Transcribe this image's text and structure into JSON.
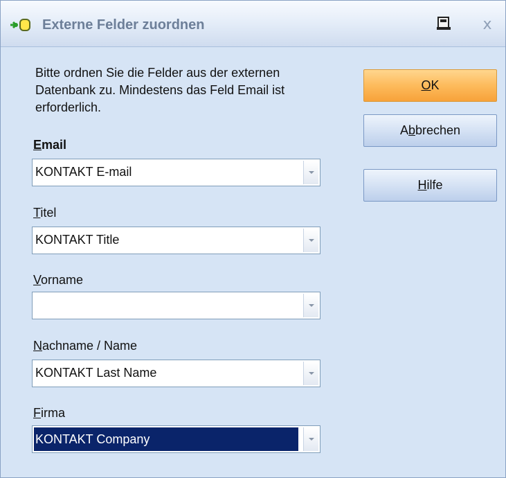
{
  "window": {
    "title": "Externe Felder zuordnen",
    "close_glyph": "x",
    "icons": {
      "title": "field-mapping-icon",
      "pin": "pin-icon",
      "close": "close-icon"
    }
  },
  "instructions": "Bitte ordnen Sie die Felder aus der externen Datenbank zu. Mindestens das Feld Email ist erforderlich.",
  "fields": [
    {
      "label_mnemonic": "E",
      "label_rest": "mail",
      "value": "KONTAKT E-mail",
      "bold": true
    },
    {
      "label_mnemonic": "T",
      "label_rest": "itel",
      "value": "KONTAKT Title"
    },
    {
      "label_mnemonic": "V",
      "label_rest": "orname",
      "value": ""
    },
    {
      "label_mnemonic": "N",
      "label_rest": "achname / Name",
      "value": "KONTAKT Last Name"
    },
    {
      "label_mnemonic": "F",
      "label_rest": "irma",
      "value": "KONTAKT Company",
      "selected": true
    }
  ],
  "buttons": {
    "ok": {
      "mnemonic": "O",
      "rest": "K"
    },
    "cancel": {
      "pre": "A",
      "mnemonic": "b",
      "rest": "brechen"
    },
    "help": {
      "mnemonic": "H",
      "rest": "ilfe"
    }
  },
  "colors": {
    "dialog_bg": "#d6e4f5",
    "default_button": "#fdbb5c",
    "selection": "#0a246a"
  }
}
